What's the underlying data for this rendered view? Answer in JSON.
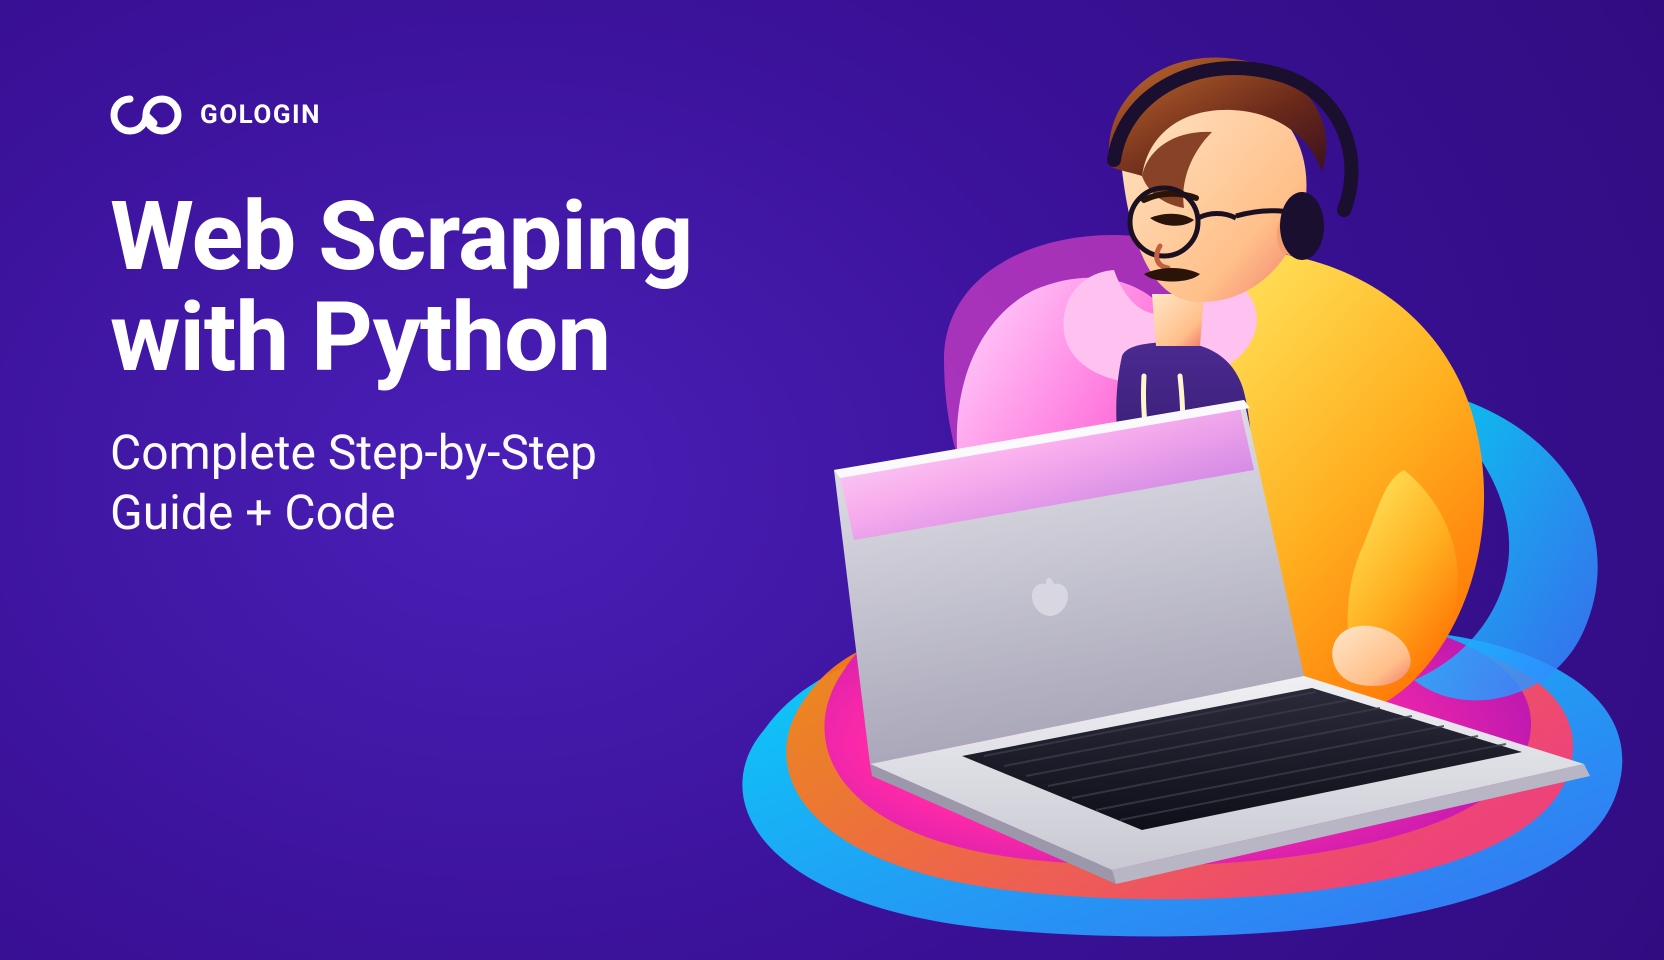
{
  "brand": {
    "name": "GOLOGIN"
  },
  "headline": {
    "line1": "Web Scraping",
    "line2": "with Python"
  },
  "subhead": {
    "line1": "Complete Step-by-Step",
    "line2": "Guide + Code"
  }
}
